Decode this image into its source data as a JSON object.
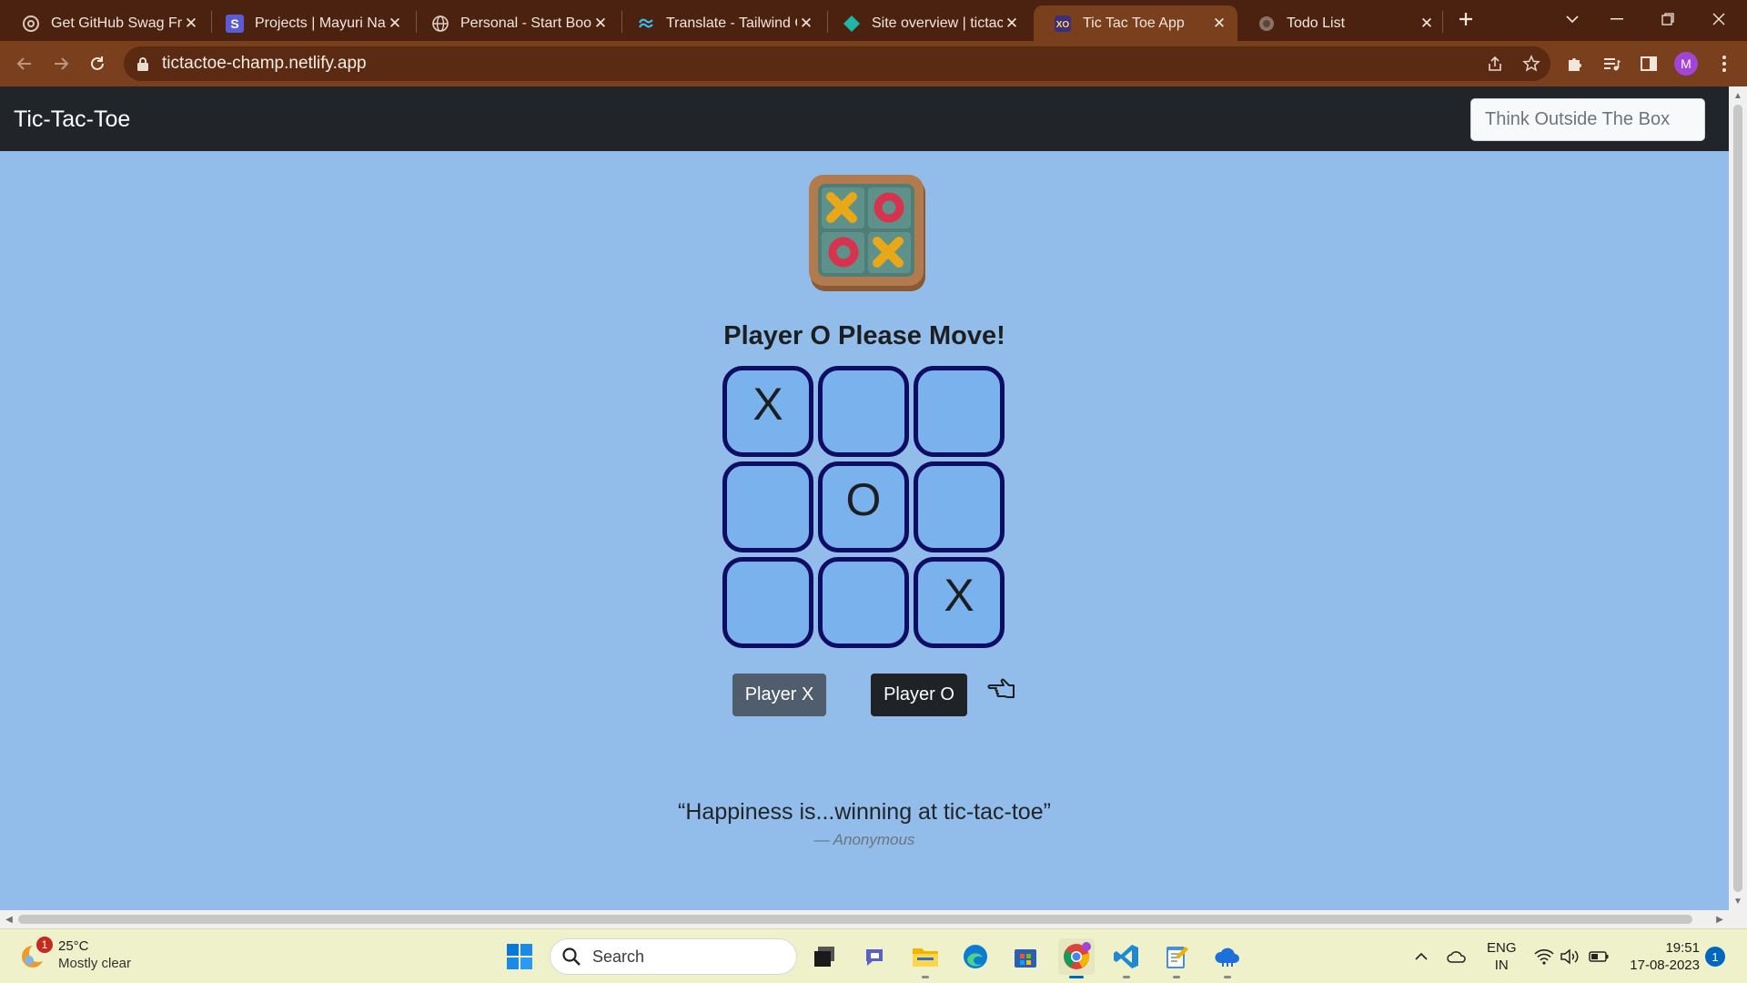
{
  "browser": {
    "tabs": [
      {
        "title": "Get GitHub Swag Free",
        "icon": "openai-icon"
      },
      {
        "title": "Projects | Mayuri Naru",
        "icon": "s-logo-icon"
      },
      {
        "title": "Personal - Start Bootstrap",
        "icon": "globe-icon"
      },
      {
        "title": "Translate - Tailwind CSS",
        "icon": "tailwind-icon"
      },
      {
        "title": "Site overview | tictactoe",
        "icon": "netlify-icon"
      },
      {
        "title": "Tic Tac Toe App",
        "icon": "tictactoe-favicon",
        "active": true
      },
      {
        "title": "Todo List",
        "icon": "globe-icon"
      }
    ],
    "url": "tictactoe-champ.netlify.app",
    "profile_initial": "M",
    "accent_color": "#7a3f1c"
  },
  "page": {
    "brand": "Tic-Tac-Toe",
    "search_placeholder": "Think Outside The Box",
    "status": "Player O Please Move!",
    "board": [
      "X",
      "",
      "",
      "",
      "O",
      "",
      "",
      "",
      "X"
    ],
    "buttons": {
      "player_x": "Player X",
      "player_o": "Player O"
    },
    "quote": "“Happiness is...winning at tic-tac-toe”",
    "author": "— Anonymous",
    "colors": {
      "background": "#92bce9",
      "cell": "#7ab2ee",
      "cell_border": "#0f0c63",
      "navbar": "#212529"
    }
  },
  "taskbar": {
    "weather": {
      "badge": "1",
      "temp": "25°C",
      "condition": "Mostly clear"
    },
    "search_label": "Search",
    "lang": [
      "ENG",
      "IN"
    ],
    "time": "19:51",
    "date": "17-08-2023",
    "notifications": "1"
  }
}
